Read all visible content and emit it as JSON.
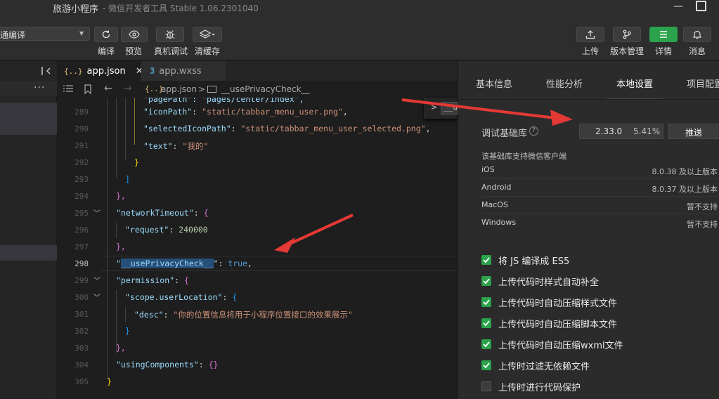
{
  "titlebar": {
    "app_name": "旅游小程序",
    "subtitle": "- 微信开发者工具 Stable 1.06.2301040"
  },
  "toolbar": {
    "mode_select": "通编译",
    "buttons": [
      {
        "label": "编译",
        "icon": "refresh-icon"
      },
      {
        "label": "预览",
        "icon": "eye-icon"
      },
      {
        "label": "真机调试",
        "icon": "bug-icon"
      },
      {
        "label": "清缓存",
        "icon": "layers-icon"
      }
    ],
    "right_buttons": [
      {
        "label": "上传",
        "icon": "upload-icon"
      },
      {
        "label": "版本管理",
        "icon": "branch-icon"
      },
      {
        "label": "详情",
        "icon": "menu-icon"
      },
      {
        "label": "消息",
        "icon": "bell-icon"
      }
    ]
  },
  "left_panel": {
    "more": "···"
  },
  "editor_tabs": [
    {
      "icon": "{..}",
      "label": "app.json",
      "active": true
    },
    {
      "icon": "css-icon",
      "label": "app.wxss",
      "active": false
    }
  ],
  "breadcrumb": {
    "file_icon": "{..}",
    "file": "app.json",
    "separator": ">",
    "symbol": "__usePrivacyCheck__"
  },
  "find_widget": {
    "value": "__us"
  },
  "code": {
    "line_numbers": [
      "289",
      "290",
      "291",
      "292",
      "293",
      "294",
      "295",
      "296",
      "297",
      "298",
      "299",
      "300",
      "301",
      "302",
      "303",
      "304",
      "305"
    ],
    "current_line": "298",
    "partial_top_line": "\"pagePath\": \"pages/center/index\",",
    "lines": [
      {
        "key": "\"iconPath\"",
        "value": "\"static/tabbar_menu_user.png\"",
        "tail": ","
      },
      {
        "key": "\"selectedIconPath\"",
        "value": "\"static/tabbar_menu_user_selected.png\"",
        "tail": ","
      },
      {
        "key": "\"text\"",
        "value": "\"我的\"",
        "tail": ""
      },
      {
        "text": "}"
      },
      {
        "text": "]"
      },
      {
        "text": "},"
      },
      {
        "key": "\"networkTimeout\"",
        "value": "{",
        "tail": ""
      },
      {
        "key": "\"request\"",
        "value": "240000",
        "tail": ""
      },
      {
        "text": "},"
      },
      {
        "key": "__usePrivacyCheck__",
        "value": "true",
        "tail": ","
      },
      {
        "key": "\"permission\"",
        "value": "{",
        "tail": ""
      },
      {
        "key": "\"scope.userLocation\"",
        "value": "{",
        "tail": ""
      },
      {
        "key": "\"desc\"",
        "value": "\"你的位置信息将用于小程序位置接口的效果展示\"",
        "tail": ""
      },
      {
        "text": "}"
      },
      {
        "text": "},"
      },
      {
        "key": "\"usingComponents\"",
        "value": "{}",
        "tail": ""
      },
      {
        "text": "}"
      }
    ]
  },
  "right_panel": {
    "tabs": [
      "基本信息",
      "性能分析",
      "本地设置",
      "项目配置"
    ],
    "active_tab": "本地设置",
    "debug_lib_label": "调试基础库",
    "help": "?",
    "version": "2.33.0",
    "version_share": "5.41%",
    "push_button": "推送",
    "support_title": "该基础库支持微信客户端",
    "platforms": [
      {
        "name": "iOS",
        "value": "8.0.38 及以上版本"
      },
      {
        "name": "Android",
        "value": "8.0.37 及以上版本"
      },
      {
        "name": "MacOS",
        "value": "暂不支持"
      },
      {
        "name": "Windows",
        "value": "暂不支持"
      }
    ],
    "options": [
      {
        "label": "将 JS 编译成 ES5",
        "checked": true
      },
      {
        "label": "上传代码时样式自动补全",
        "checked": true
      },
      {
        "label": "上传代码时自动压缩样式文件",
        "checked": true
      },
      {
        "label": "上传代码时自动压缩脚本文件",
        "checked": true
      },
      {
        "label": "上传代码时自动压缩wxml文件",
        "checked": true
      },
      {
        "label": "上传时过滤无依赖文件",
        "checked": true
      },
      {
        "label": "上传时进行代码保护",
        "checked": false
      }
    ]
  },
  "colors": {
    "accent_green": "#2ba24c",
    "annotation_red": "#e53935"
  }
}
